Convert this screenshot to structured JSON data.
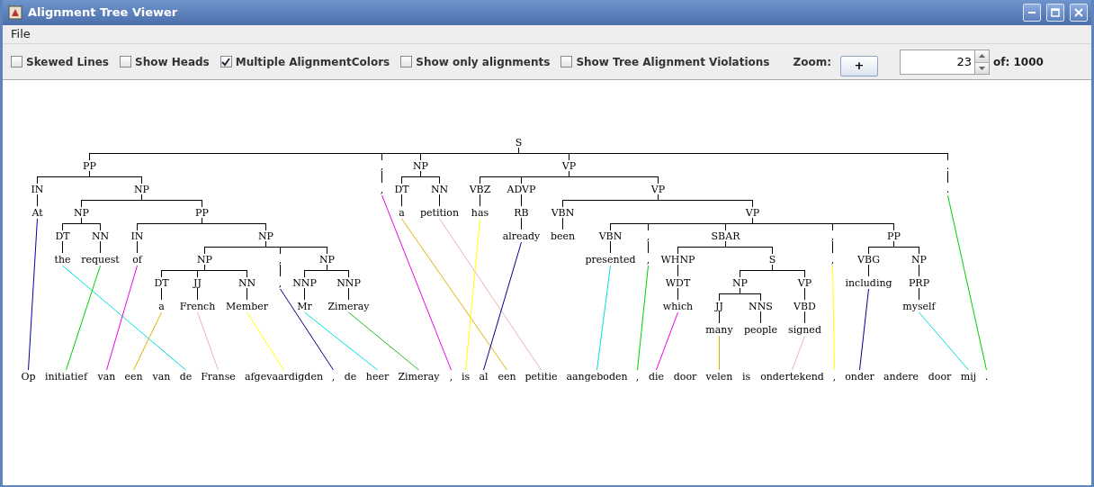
{
  "window": {
    "title": "Alignment Tree Viewer"
  },
  "menu": [
    "File"
  ],
  "toolbar": {
    "checkboxes": [
      {
        "label": "Skewed Lines",
        "checked": false
      },
      {
        "label": "Show Heads",
        "checked": false
      },
      {
        "label": "Multiple AlignmentColors",
        "checked": true
      },
      {
        "label": "Show only alignments",
        "checked": false
      },
      {
        "label": "Show Tree Alignment Violations",
        "checked": false
      }
    ],
    "zoom": {
      "label": "Zoom:",
      "button": "+"
    },
    "sentence": {
      "value": "23",
      "total": "of: 1000"
    }
  },
  "tree": {
    "label": "S",
    "children": [
      {
        "label": "PP",
        "children": [
          {
            "label": "IN",
            "children": [
              {
                "word": "At"
              }
            ]
          },
          {
            "label": "NP",
            "children": [
              {
                "label": "NP",
                "children": [
                  {
                    "label": "DT",
                    "children": [
                      {
                        "word": "the"
                      }
                    ]
                  },
                  {
                    "label": "NN",
                    "children": [
                      {
                        "word": "request"
                      }
                    ]
                  }
                ]
              },
              {
                "label": "PP",
                "children": [
                  {
                    "label": "IN",
                    "children": [
                      {
                        "word": "of"
                      }
                    ]
                  },
                  {
                    "label": "NP",
                    "children": [
                      {
                        "label": "NP",
                        "children": [
                          {
                            "label": "DT",
                            "children": [
                              {
                                "word": "a"
                              }
                            ]
                          },
                          {
                            "label": "JJ",
                            "children": [
                              {
                                "word": "French"
                              }
                            ]
                          },
                          {
                            "label": "NN",
                            "children": [
                              {
                                "word": "Member"
                              }
                            ]
                          }
                        ]
                      },
                      {
                        "label": ",",
                        "children": [
                          {
                            "word": ","
                          }
                        ]
                      },
                      {
                        "label": "NP",
                        "children": [
                          {
                            "label": "NNP",
                            "children": [
                              {
                                "word": "Mr"
                              }
                            ]
                          },
                          {
                            "label": "NNP",
                            "children": [
                              {
                                "word": "Zimeray"
                              }
                            ]
                          }
                        ]
                      }
                    ]
                  }
                ]
              }
            ]
          }
        ]
      },
      {
        "label": ",",
        "children": [
          {
            "word": ","
          }
        ]
      },
      {
        "label": "NP",
        "children": [
          {
            "label": "DT",
            "children": [
              {
                "word": "a"
              }
            ]
          },
          {
            "label": "NN",
            "children": [
              {
                "word": "petition"
              }
            ]
          }
        ]
      },
      {
        "label": "VP",
        "children": [
          {
            "label": "VBZ",
            "children": [
              {
                "word": "has"
              }
            ]
          },
          {
            "label": "ADVP",
            "children": [
              {
                "label": "RB",
                "children": [
                  {
                    "word": "already"
                  }
                ]
              }
            ]
          },
          {
            "label": "VP",
            "children": [
              {
                "label": "VBN",
                "children": [
                  {
                    "word": "been"
                  }
                ]
              },
              {
                "label": "VP",
                "children": [
                  {
                    "label": "VBN",
                    "children": [
                      {
                        "word": "presented"
                      }
                    ]
                  },
                  {
                    "label": ",",
                    "children": [
                      {
                        "word": ","
                      }
                    ]
                  },
                  {
                    "label": "SBAR",
                    "children": [
                      {
                        "label": "WHNP",
                        "children": [
                          {
                            "label": "WDT",
                            "children": [
                              {
                                "word": "which"
                              }
                            ]
                          }
                        ]
                      },
                      {
                        "label": "S",
                        "children": [
                          {
                            "label": "NP",
                            "children": [
                              {
                                "label": "JJ",
                                "children": [
                                  {
                                    "word": "many"
                                  }
                                ]
                              },
                              {
                                "label": "NNS",
                                "children": [
                                  {
                                    "word": "people"
                                  }
                                ]
                              }
                            ]
                          },
                          {
                            "label": "VP",
                            "children": [
                              {
                                "label": "VBD",
                                "children": [
                                  {
                                    "word": "signed"
                                  }
                                ]
                              }
                            ]
                          }
                        ]
                      }
                    ]
                  },
                  {
                    "label": ",",
                    "children": [
                      {
                        "word": ","
                      }
                    ]
                  },
                  {
                    "label": "PP",
                    "children": [
                      {
                        "label": "VBG",
                        "children": [
                          {
                            "word": "including"
                          }
                        ]
                      },
                      {
                        "label": "NP",
                        "children": [
                          {
                            "label": "PRP",
                            "children": [
                              {
                                "word": "myself"
                              }
                            ]
                          }
                        ]
                      }
                    ]
                  }
                ]
              }
            ]
          }
        ]
      },
      {
        "label": ".",
        "children": [
          {
            "word": "."
          }
        ]
      }
    ]
  },
  "target_words": [
    "Op",
    "initiatief",
    "van",
    "een",
    "van",
    "de",
    "Franse",
    "afgevaardigden",
    ",",
    "de",
    "heer",
    "Zimeray",
    ",",
    "is",
    "al",
    "een",
    "petitie",
    "aangeboden",
    ",",
    "die",
    "door",
    "velen",
    "is",
    "ondertekend",
    ",",
    "onder",
    "andere",
    "door",
    "mij",
    "."
  ],
  "alignments": [
    {
      "color": "#0000aa"
    },
    {
      "color": "#00e0e0"
    },
    {
      "color": "#00d000"
    },
    {
      "color": "#ee00ee"
    },
    {
      "color": "#e0b000"
    },
    {
      "color": "#f0b0b0"
    },
    {
      "color": "#ffff00"
    },
    {
      "color": "#000088"
    },
    {
      "color": "#00e0e0"
    },
    {
      "color": "#22bb22"
    },
    {
      "color": "#ee00ee"
    },
    {
      "color": "#e0b000"
    },
    {
      "color": "#f0b0b0"
    },
    {
      "color": "#ffff00"
    },
    {
      "color": "#000088"
    },
    {
      "color": "#00e0e0"
    },
    {
      "color": "#00d000"
    },
    {
      "color": "#ee00ee"
    },
    {
      "color": "#e0b000"
    },
    {
      "color": "#f0b0b0"
    },
    {
      "color": "#ffff00"
    },
    {
      "color": "#000088"
    },
    {
      "color": "#00e0e0"
    },
    {
      "color": "#00d000"
    }
  ]
}
